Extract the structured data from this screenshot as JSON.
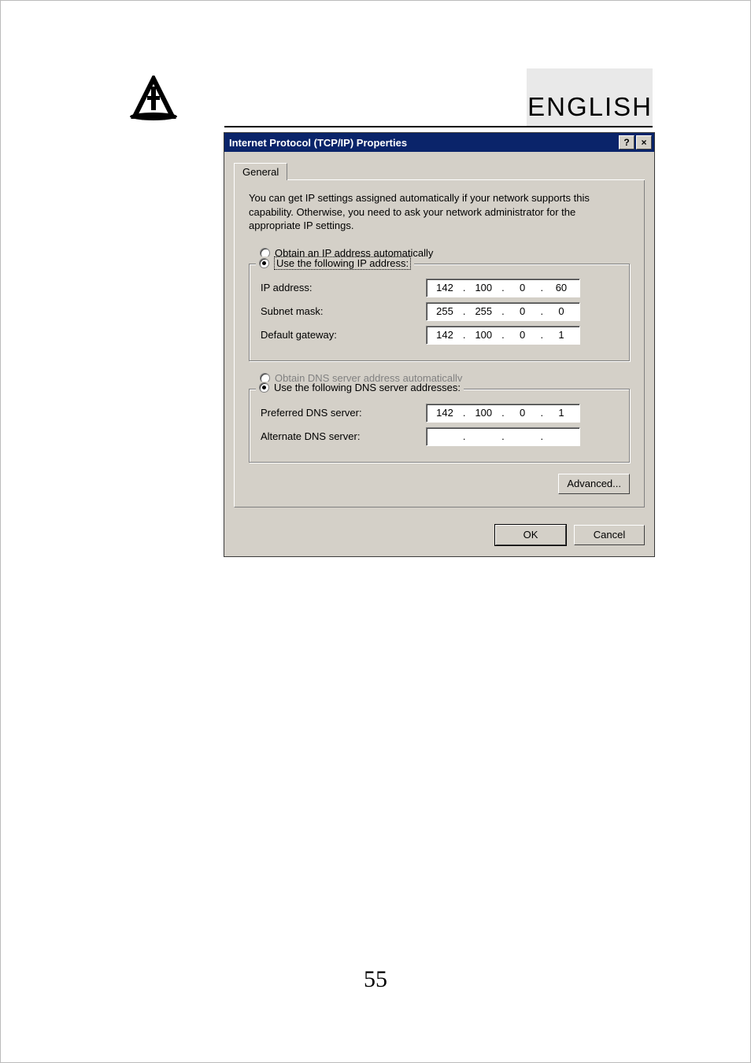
{
  "page": {
    "language_label": "ENGLISH",
    "page_number": "55"
  },
  "dialog": {
    "title": "Internet Protocol (TCP/IP) Properties",
    "help_btn": "?",
    "close_btn": "×",
    "tab_general": "General",
    "description": "You can get IP settings assigned automatically if your network supports this capability. Otherwise, you need to ask your network administrator for the appropriate IP settings.",
    "ip": {
      "radio_auto": "Obtain an IP address automatically",
      "radio_manual": "Use the following IP address:",
      "label_ip": "IP address:",
      "label_subnet": "Subnet mask:",
      "label_gateway": "Default gateway:",
      "ip_octets": [
        "142",
        "100",
        "0",
        "60"
      ],
      "subnet_octets": [
        "255",
        "255",
        "0",
        "0"
      ],
      "gateway_octets": [
        "142",
        "100",
        "0",
        "1"
      ]
    },
    "dns": {
      "radio_auto": "Obtain DNS server address automatically",
      "radio_manual": "Use the following DNS server addresses:",
      "label_preferred": "Preferred DNS server:",
      "label_alternate": "Alternate DNS server:",
      "preferred_octets": [
        "142",
        "100",
        "0",
        "1"
      ],
      "alternate_octets": [
        "",
        "",
        "",
        ""
      ]
    },
    "advanced_btn": "Advanced...",
    "ok_btn": "OK",
    "cancel_btn": "Cancel"
  }
}
